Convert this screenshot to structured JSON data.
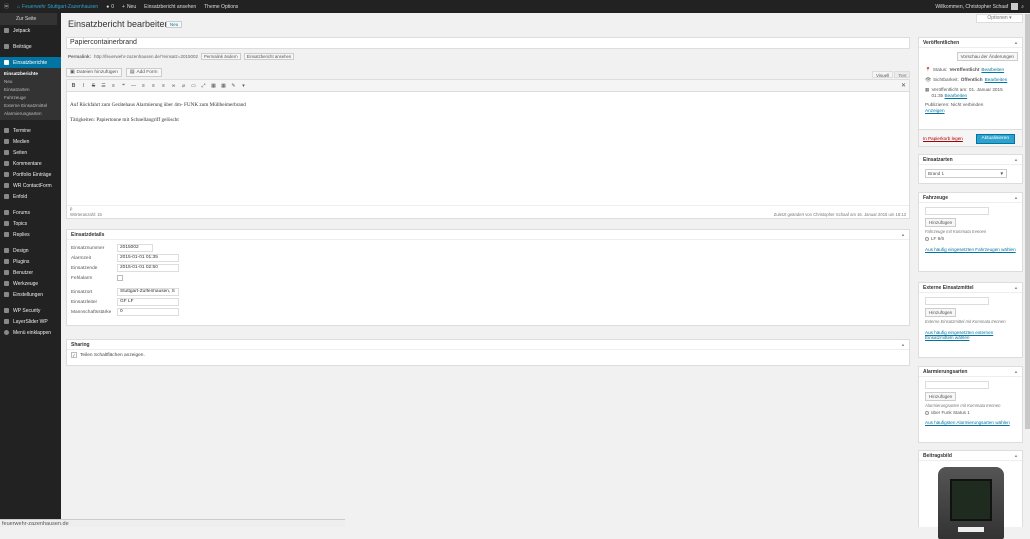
{
  "adminbar": {
    "site": "Feuerwehr Stuttgart-Zazenhausen",
    "comments": "0",
    "new": "Neu",
    "view": "Einsatzbericht ansehen",
    "theme": "Theme Options",
    "welcome": "Willkommen, Christopher Schaaf"
  },
  "site_dropdown": "Zur Seite",
  "sidebar": {
    "items": [
      {
        "label": "Jetpack"
      },
      {
        "label": "Beiträge"
      }
    ],
    "active": "Einsatzberichte",
    "sub_head": "Einsatzberichte",
    "sub": [
      "Neu",
      "Einsatzarten",
      "Fahrzeuge",
      "Externe Einsatzmittel",
      "Alarmierungsarten"
    ],
    "items2": [
      {
        "label": "Termine"
      },
      {
        "label": "Medien"
      },
      {
        "label": "Seiten"
      },
      {
        "label": "Kommentare"
      },
      {
        "label": "Portfolio Einträge"
      },
      {
        "label": "WR ContactForm"
      },
      {
        "label": "Enfold"
      },
      {
        "label": "Forums"
      },
      {
        "label": "Topics"
      },
      {
        "label": "Replies"
      },
      {
        "label": "Design"
      },
      {
        "label": "Plugins"
      },
      {
        "label": "Benutzer"
      },
      {
        "label": "Werkzeuge"
      },
      {
        "label": "Einstellungen"
      },
      {
        "label": "WP Security"
      },
      {
        "label": "LayerSlider WP"
      },
      {
        "label": "Menü einklappen"
      }
    ]
  },
  "screen_options": "Optionen ▾",
  "page": {
    "title": "Einsatzbericht bearbeiten",
    "new_badge": "Neu",
    "post_title": "Papiercontainerbrand",
    "permalink_label": "Permalink:",
    "permalink_url": "http://feuerwehr-zazenhausen.de/?einsatz=2015002",
    "permalink_change": "Permalink ändern",
    "view_btn": "Einsatzbericht ansehen"
  },
  "media": {
    "add": "Dateien hinzufügen",
    "form": "Add Form"
  },
  "editor": {
    "tab_visual": "Visuell",
    "tab_text": "Text",
    "para1": "Auf Rückfahrt zum Gerätehaus Alarmierung über 4m- FUNK zum Müllheimerbrand",
    "para2": "Tätigkeiten: Papiertonne mit Schnellangriff gelöscht",
    "path": "p",
    "wordcount": "Wörteranzahl: 15",
    "lastedit": "Zuletzt geändert von Christopher Schaaf am 16. Januar 2015 um 16:13"
  },
  "einsatzdetails": {
    "title": "Einsatzdetails",
    "fields": [
      {
        "label": "Einsatznummer",
        "value": "2015002"
      },
      {
        "label": "Alarmzeit",
        "value": "2015-01-01 01:35"
      },
      {
        "label": "Einsatzende",
        "value": "2015-01-01 02:50"
      },
      {
        "label": "Fehlalarm",
        "value": ""
      },
      {
        "label": "Einsatzort",
        "value": "Stuttgart-Zuffenhausen, S"
      },
      {
        "label": "Einsatzleiter",
        "value": "GF LF"
      },
      {
        "label": "Mannschaftsstärke",
        "value": "0"
      }
    ]
  },
  "sharing": {
    "title": "Sharing",
    "checkbox": "Teilen Schaltflächen anzeigen."
  },
  "publish": {
    "title": "Veröffentlichen",
    "preview": "Vorschau der Änderungen",
    "status_label": "Status:",
    "status": "Veröffentlicht",
    "edit": "Bearbeiten",
    "visibility_label": "Sichtbarkeit:",
    "visibility": "Öffentlich",
    "published_on": "Veröffentlicht am: 01. Januar 2015",
    "published_time": "01:35",
    "public": "Publizieren: Nicht verbinden",
    "show": "Anzeigen",
    "trash": "In Papierkorb legen",
    "update": "Aktualisieren"
  },
  "einsatzarten": {
    "title": "Einsatzarten",
    "selected": "Brand 1"
  },
  "fahrzeuge": {
    "title": "Fahrzeuge",
    "add": "Hinzufügen",
    "hint": "Fahrzeuge mit Kommata trennen",
    "option": "LF 8/6",
    "link": "Aus häufig eingesetzten Fahrzeugen wählen"
  },
  "externe": {
    "title": "Externe Einsatzmittel",
    "add": "Hinzufügen",
    "hint": "Externe Einsatzmittel mit Kommata trennen",
    "link": "Aus häufig eingesetzten externen Einsatzmitteln wählen"
  },
  "alarmierung": {
    "title": "Alarmierungsarten",
    "add": "Hinzufügen",
    "hint": "Alarmierungsarten mit Kommata trennen",
    "option": "über Funk Status 1",
    "link": "Aus häufigsten Alarmierungsarten wählen"
  },
  "beitragsbild": {
    "title": "Beitragsbild"
  },
  "status_url": "feuerwehr-zazenhausen.de",
  "colors": {
    "accent": "#0074a2",
    "adminbar": "#222222",
    "button": "#2ea2cc"
  }
}
